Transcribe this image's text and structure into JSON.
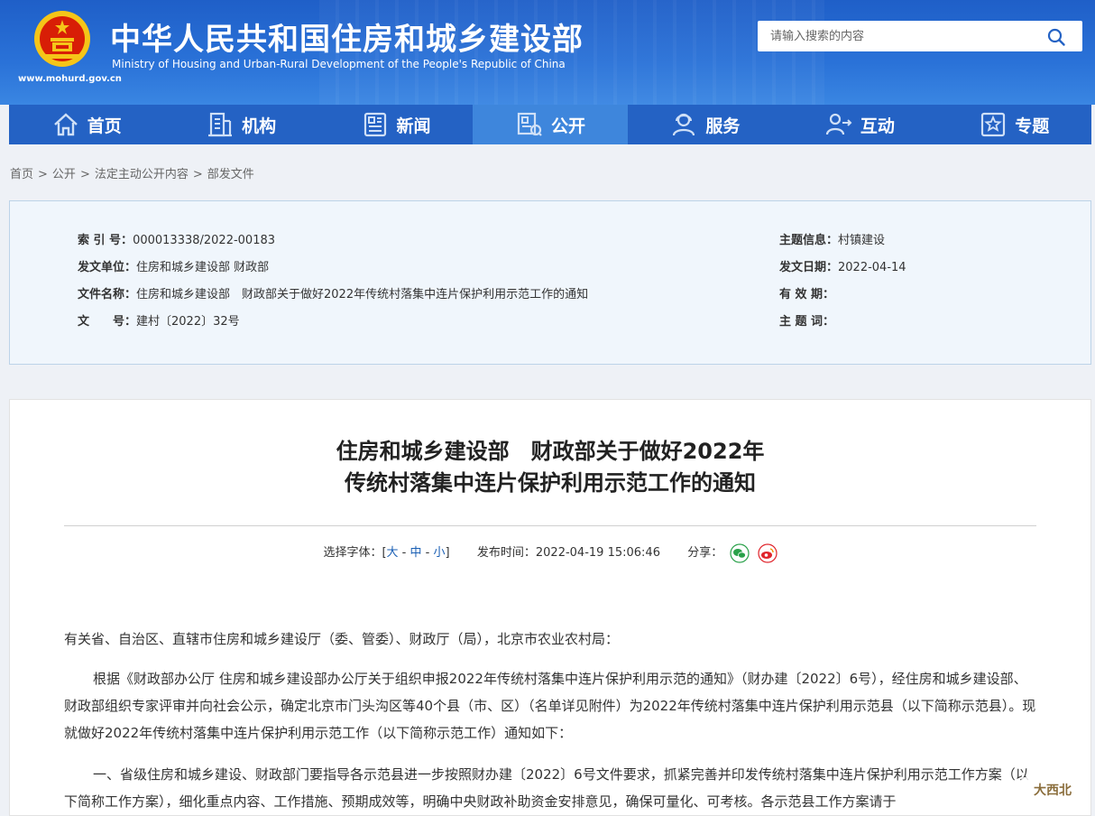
{
  "header": {
    "title_cn": "中华人民共和国住房和城乡建设部",
    "title_en": "Ministry of Housing and Urban-Rural Development of the People's Republic of China",
    "url": "www.mohurd.gov.cn",
    "search_placeholder": "请输入搜索的内容"
  },
  "nav": [
    {
      "label": "首页",
      "icon": "home-icon"
    },
    {
      "label": "机构",
      "icon": "building-icon"
    },
    {
      "label": "新闻",
      "icon": "newspaper-icon"
    },
    {
      "label": "公开",
      "icon": "document-icon"
    },
    {
      "label": "服务",
      "icon": "service-icon"
    },
    {
      "label": "互动",
      "icon": "interaction-icon"
    },
    {
      "label": "专题",
      "icon": "star-icon"
    }
  ],
  "breadcrumb": [
    "首页",
    "公开",
    "法定主动公开内容",
    "部发文件"
  ],
  "meta": {
    "index_label": "索 引 号：",
    "index_value": "000013338/2022-00183",
    "issuer_label": "发文单位：",
    "issuer_value": "住房和城乡建设部 财政部",
    "docname_label": "文件名称：",
    "docname_value": "住房和城乡建设部　财政部关于做好2022年传统村落集中连片保护利用示范工作的通知",
    "docno_label": "文　　号：",
    "docno_value": "建村〔2022〕32号",
    "topic_label": "主题信息：",
    "topic_value": "村镇建设",
    "date_label": "发文日期：",
    "date_value": "2022-04-14",
    "valid_label": "有 效 期：",
    "valid_value": "",
    "keyword_label": "主 题 词：",
    "keyword_value": ""
  },
  "article": {
    "title_line1": "住房和城乡建设部　财政部关于做好2022年",
    "title_line2": "传统村落集中连片保护利用示范工作的通知",
    "font_label": "选择字体：[",
    "font_large": "大",
    "font_medium": "中",
    "font_small": "小",
    "font_close": "]",
    "publish_label": "发布时间：",
    "publish_time": "2022-04-19 15:06:46",
    "share_label": "分享：",
    "p1": "有关省、自治区、直辖市住房和城乡建设厅（委、管委）、财政厅（局），北京市农业农村局：",
    "p2": "根据《财政部办公厅 住房和城乡建设部办公厅关于组织申报2022年传统村落集中连片保护利用示范的通知》（财办建〔2022〕6号），经住房和城乡建设部、财政部组织专家评审并向社会公示，确定北京市门头沟区等40个县（市、区）（名单详见附件）为2022年传统村落集中连片保护利用示范县（以下简称示范县）。现就做好2022年传统村落集中连片保护利用示范工作（以下简称示范工作）通知如下：",
    "p3": "一、省级住房和城乡建设、财政部门要指导各示范县进一步按照财办建〔2022〕6号文件要求，抓紧完善并印发传统村落集中连片保护利用示范工作方案（以下简称工作方案），细化重点内容、工作措施、预期成效等，明确中央财政补助资金安排意见，确保可量化、可考核。各示范县工作方案请于"
  },
  "watermark": "大西北"
}
